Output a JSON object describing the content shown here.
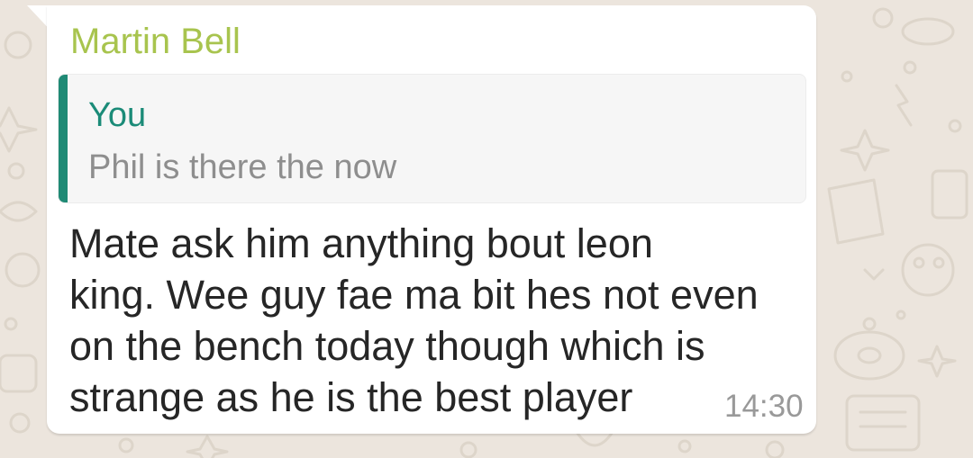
{
  "chat": {
    "message": {
      "sender": "Martin Bell",
      "reply": {
        "author": "You",
        "text": "Phil is there the now"
      },
      "text": "Mate ask him anything bout leon\nking. Wee guy fae ma bit hes not even\non the bench today though which is\nstrange as he is the best player",
      "time": "14:30"
    }
  },
  "colors": {
    "wallpaper": "#ece5dd",
    "bubble": "#ffffff",
    "sender_name": "#a8c44e",
    "quote_bar": "#1f8a75",
    "quote_author": "#1b8b78",
    "quote_text": "#8e8e8e",
    "message_text": "#262626",
    "timestamp": "#999999"
  },
  "icons": {
    "wallpaper_doodles": "doodle-pattern"
  }
}
